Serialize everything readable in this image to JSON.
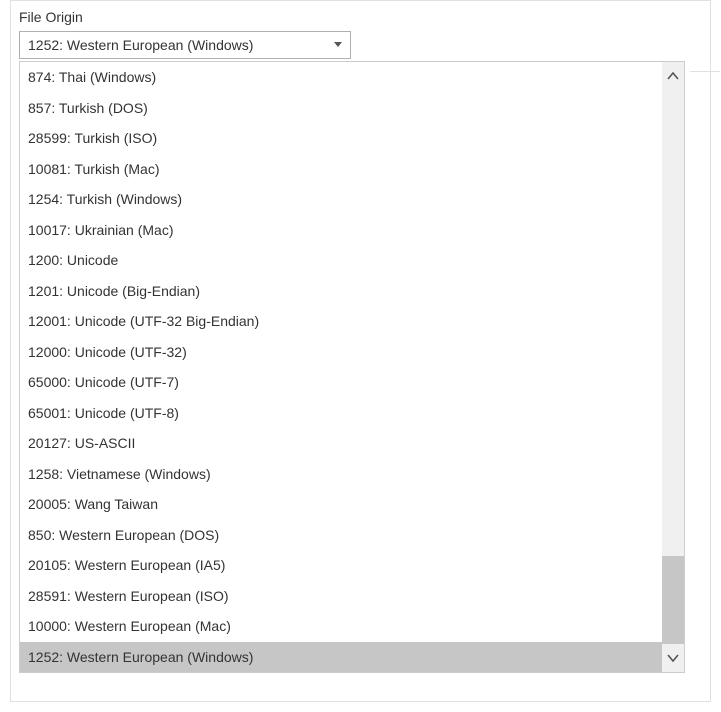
{
  "label": "File Origin",
  "selected": "1252: Western European (Windows)",
  "options": [
    "874: Thai (Windows)",
    "857: Turkish (DOS)",
    "28599: Turkish (ISO)",
    "10081: Turkish (Mac)",
    "1254: Turkish (Windows)",
    "10017: Ukrainian (Mac)",
    "1200: Unicode",
    "1201: Unicode (Big-Endian)",
    "12001: Unicode (UTF-32 Big-Endian)",
    "12000: Unicode (UTF-32)",
    "65000: Unicode (UTF-7)",
    "65001: Unicode (UTF-8)",
    "20127: US-ASCII",
    "1258: Vietnamese (Windows)",
    "20005: Wang Taiwan",
    "850: Western European (DOS)",
    "20105: Western European (IA5)",
    "28591: Western European (ISO)",
    "10000: Western European (Mac)",
    "1252: Western European (Windows)"
  ],
  "selectedIndex": 19
}
